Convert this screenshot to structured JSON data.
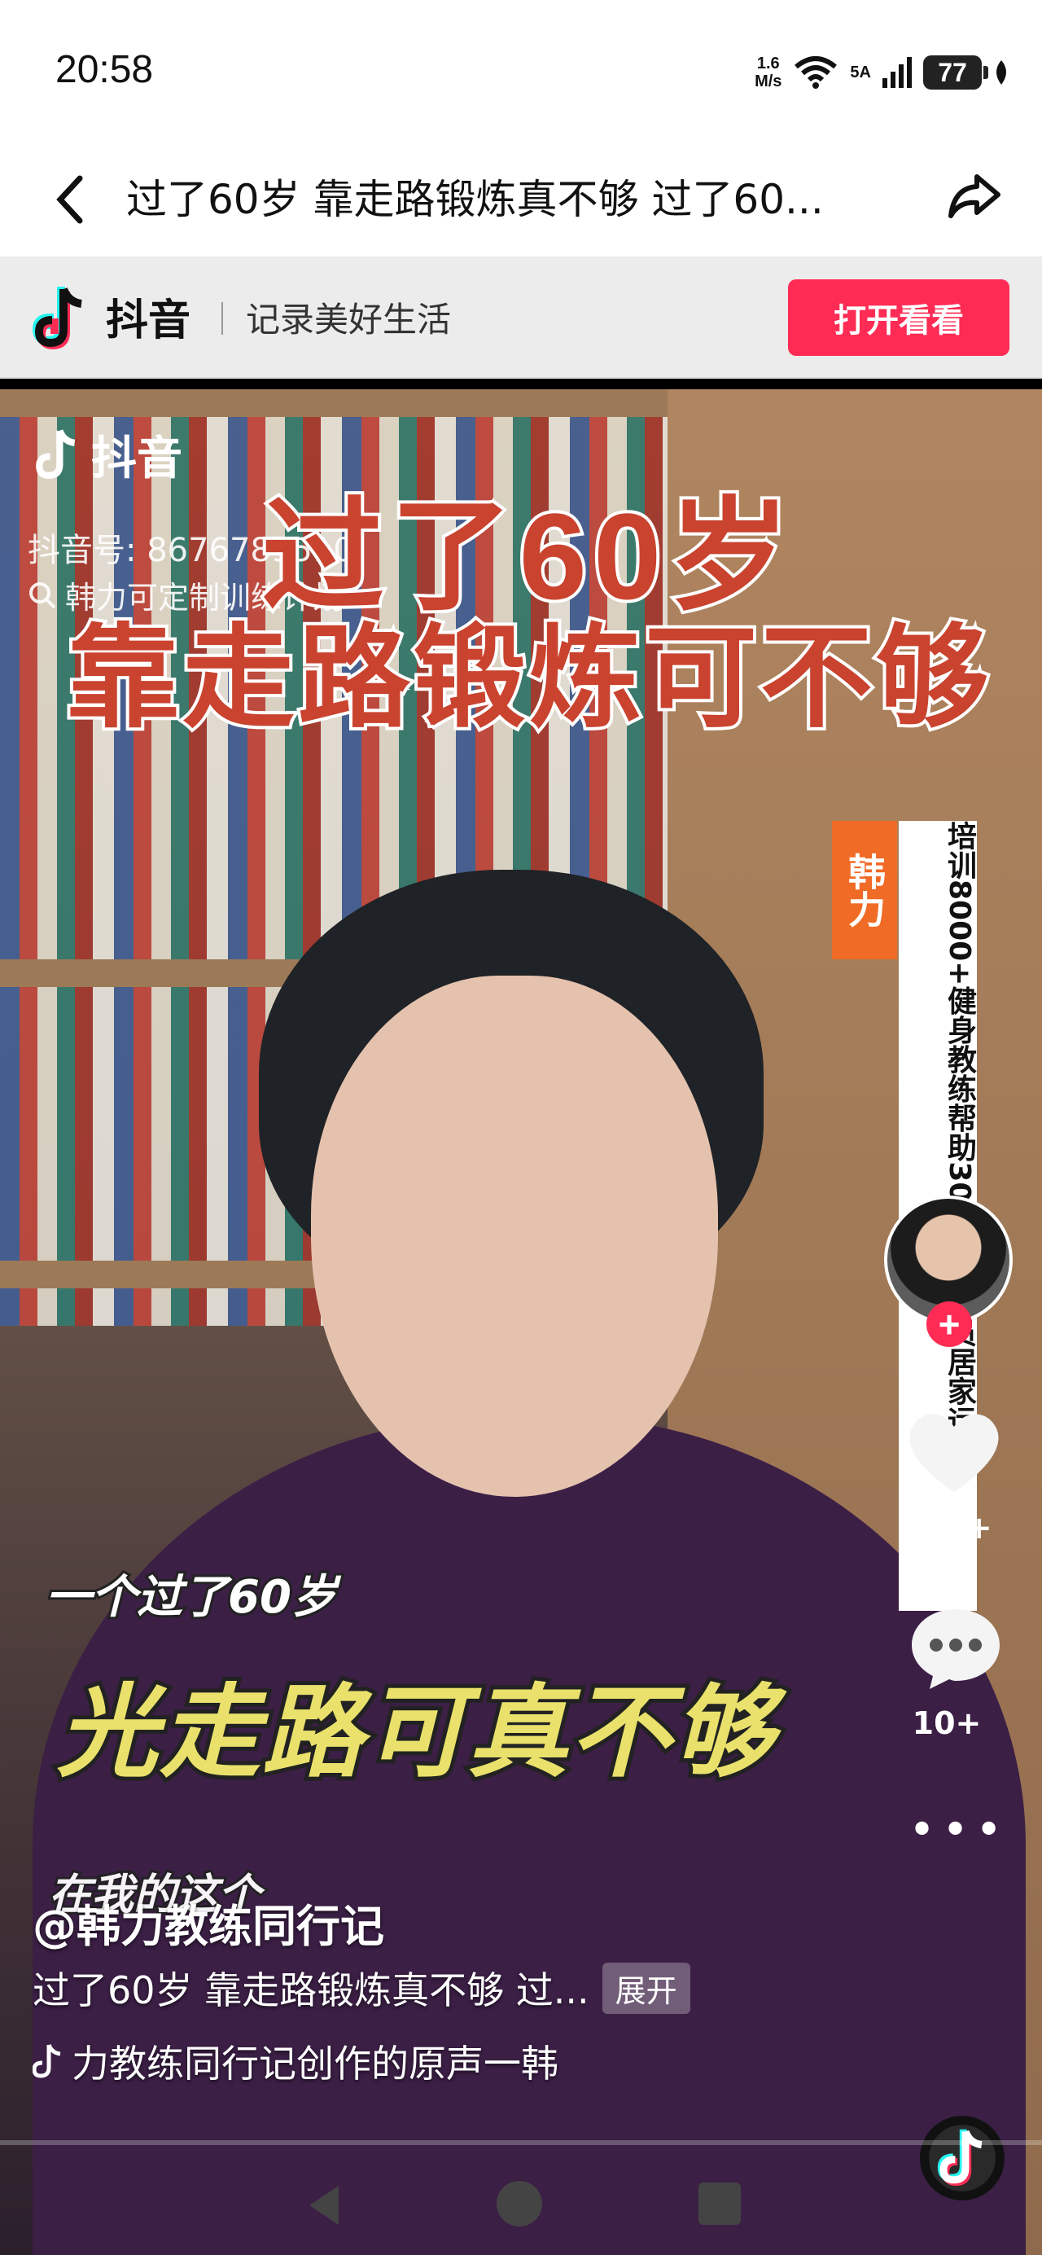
{
  "status": {
    "time": "20:58",
    "net_speed_top": "1.6",
    "net_speed_bottom": "M/s",
    "signal_label": "5A",
    "battery": "77"
  },
  "titlebar": {
    "title": "过了60岁 靠走路锻炼真不够 过了60..."
  },
  "banner": {
    "app_name": "抖音",
    "slogan": "记录美好生活",
    "open_button": "打开看看"
  },
  "video": {
    "watermark_app": "抖音",
    "watermark_id": "抖音号: 8676789510",
    "watermark_search": "韩力可定制训练计划",
    "headline_line1": "过了60岁",
    "headline_line2": "靠走路锻炼可不够",
    "side_badge": "韩力",
    "side_text": "培训8000+健身教练帮助30000+会员居家运动",
    "caption_small": "一个过了60岁",
    "caption_big": "光走路可真不够",
    "caption_next": "在我的这个"
  },
  "actions": {
    "follow": "+",
    "like_count": "100+",
    "comment_count": "10+",
    "more": "•••"
  },
  "info": {
    "author": "@韩力教练同行记",
    "description": "过了60岁 靠走路锻炼真不够 过...",
    "expand": "展开",
    "music": "力教练同行记创作的原声一韩"
  },
  "colors": {
    "brand_red": "#fe2c55",
    "headline_red": "#c9432f",
    "caption_yellow": "#e9e16b",
    "badge_orange": "#f06b25"
  },
  "icons": [
    "back-arrow-icon",
    "share-icon",
    "douyin-logo-icon",
    "search-icon",
    "heart-icon",
    "comment-icon",
    "more-icon",
    "music-note-icon",
    "nav-back-icon",
    "nav-home-icon",
    "nav-recent-icon"
  ]
}
